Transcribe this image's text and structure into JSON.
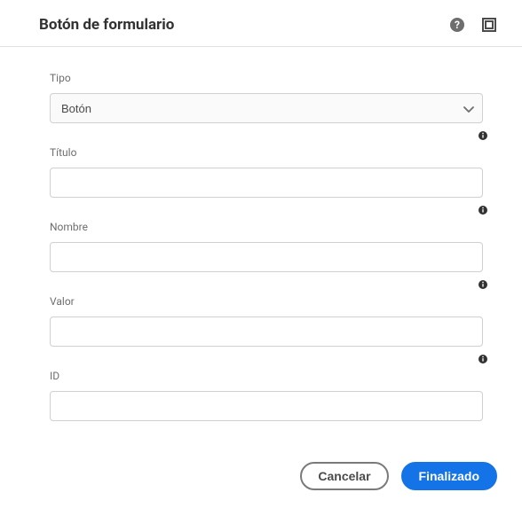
{
  "header": {
    "title": "Botón de formulario"
  },
  "fields": {
    "type": {
      "label": "Tipo",
      "value": "Botón"
    },
    "title": {
      "label": "Título",
      "value": ""
    },
    "name": {
      "label": "Nombre",
      "value": ""
    },
    "value": {
      "label": "Valor",
      "value": ""
    },
    "id": {
      "label": "ID",
      "value": ""
    }
  },
  "footer": {
    "cancel": "Cancelar",
    "done": "Finalizado"
  }
}
